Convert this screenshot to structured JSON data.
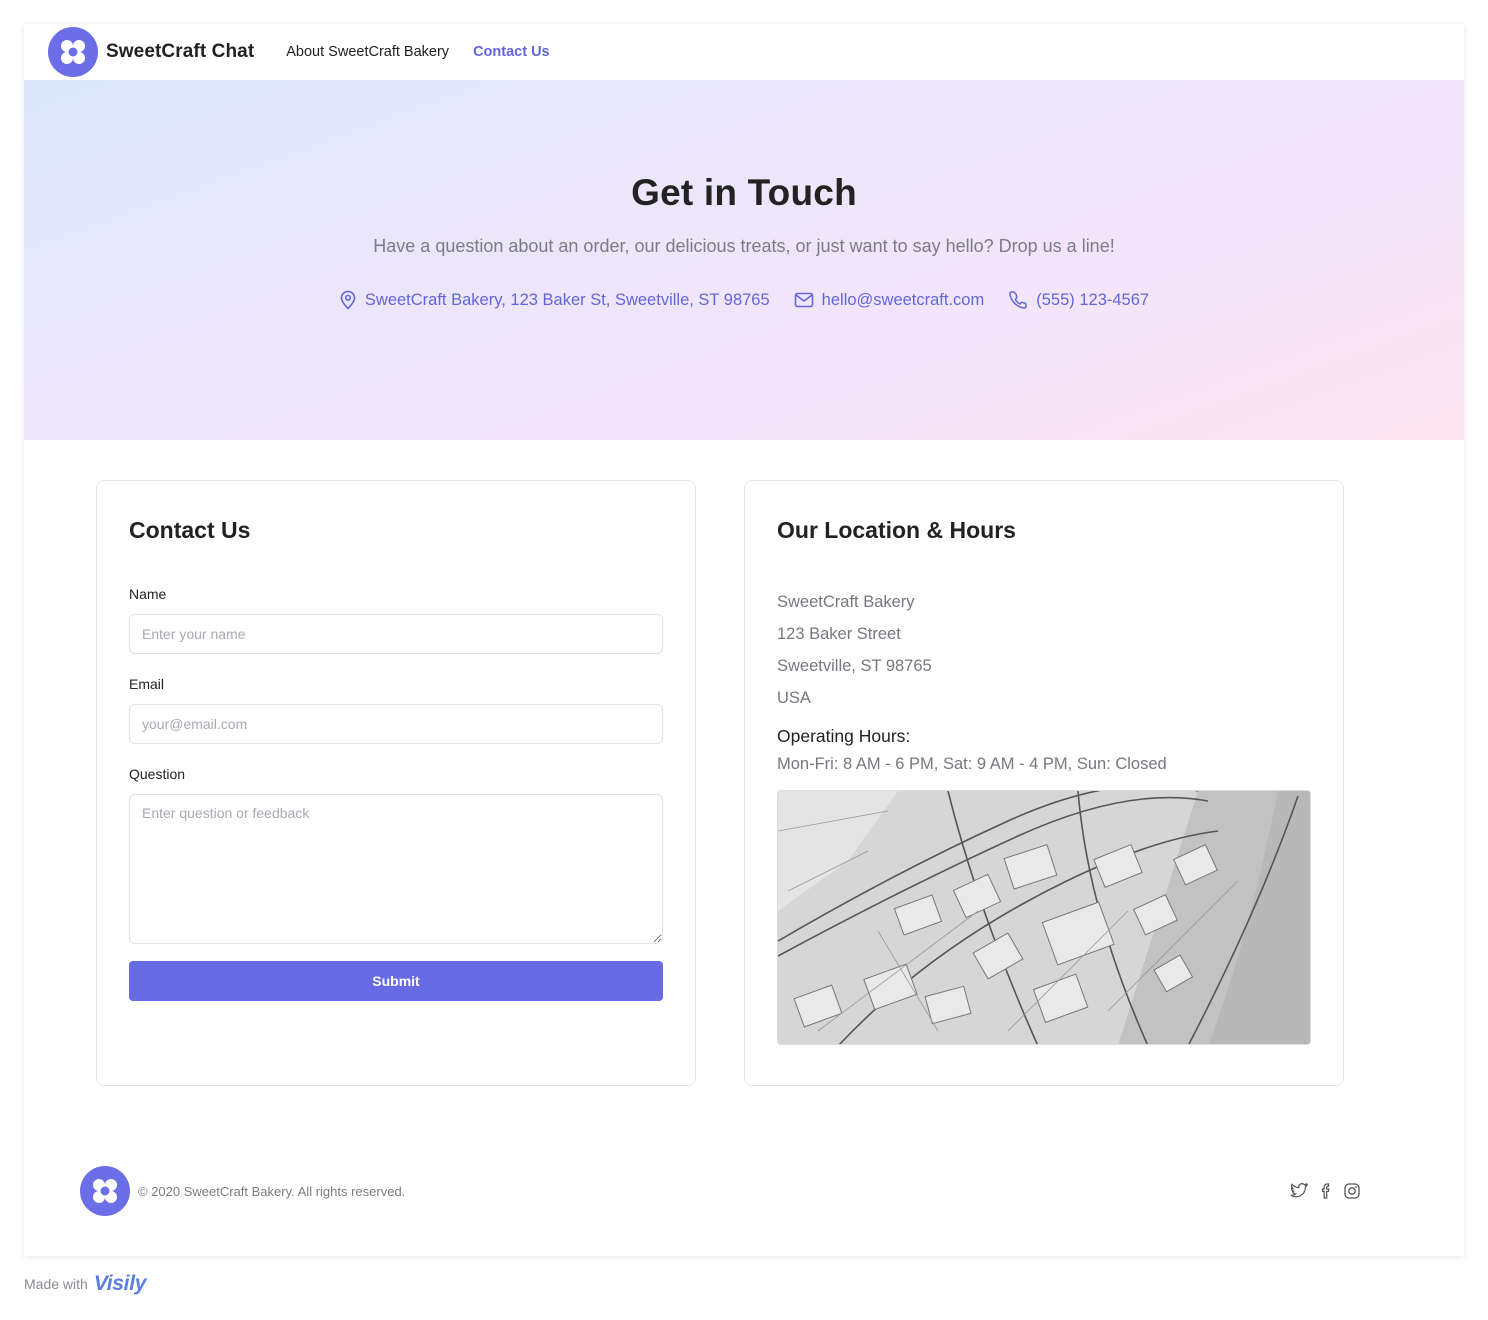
{
  "header": {
    "brand": "SweetCraft Chat",
    "nav": [
      {
        "label": "About SweetCraft Bakery"
      },
      {
        "label": "Contact Us"
      }
    ]
  },
  "hero": {
    "title": "Get in Touch",
    "lead": "Have a question about an order, our delicious treats, or just want to say hello? Drop us a line!",
    "address": "SweetCraft Bakery, 123 Baker St, Sweetville, ST 98765",
    "email": "hello@sweetcraft.com",
    "phone": "(555) 123-4567"
  },
  "form": {
    "title": "Contact Us",
    "name_label": "Name",
    "name_placeholder": "Enter your name",
    "email_label": "Email",
    "email_placeholder": "your@email.com",
    "question_label": "Question",
    "question_placeholder": "Enter question or feedback",
    "submit_label": "Submit"
  },
  "location": {
    "title": "Our Location & Hours",
    "address_lines": [
      "SweetCraft Bakery",
      "123 Baker Street",
      "Sweetville, ST 98765",
      "USA"
    ],
    "hours_title": "Operating Hours:",
    "hours": "Mon-Fri: 8 AM - 6 PM, Sat: 9 AM - 4 PM, Sun: Closed",
    "map_icon": "map-sketch-image"
  },
  "footer": {
    "copyright": "© 2020 SweetCraft Bakery. All rights reserved.",
    "social": [
      "twitter-icon",
      "facebook-icon",
      "instagram-icon"
    ]
  },
  "badge": {
    "made_with": "Made with",
    "brand": "Visily"
  },
  "colors": {
    "accent": "#6266d9",
    "button": "#666ae3",
    "logo": "#6b6ee6"
  }
}
